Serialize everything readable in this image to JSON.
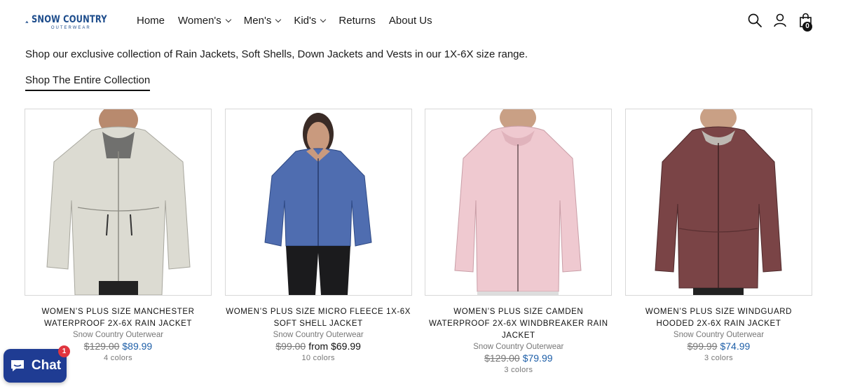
{
  "brand": {
    "name": "SNOW COUNTRY",
    "sub": "OUTERWEAR"
  },
  "nav": [
    {
      "label": "Home",
      "dropdown": false
    },
    {
      "label": "Women's",
      "dropdown": true
    },
    {
      "label": "Men's",
      "dropdown": true
    },
    {
      "label": "Kid's",
      "dropdown": true
    },
    {
      "label": "Returns",
      "dropdown": false
    },
    {
      "label": "About Us",
      "dropdown": false
    }
  ],
  "cart_count": "0",
  "intro": "Shop our exclusive collection of Rain Jackets, Soft Shells, Down Jackets and Vests in our 1X-6X size range.",
  "shop_link": "Shop The Entire Collection",
  "products": [
    {
      "title": "WOMEN’S PLUS SIZE MANCHESTER WATERPROOF 2X-6X RAIN JACKET",
      "vendor": "Snow Country Outerwear",
      "old_price": "$129.00",
      "price": "$89.99",
      "from": "",
      "colors": "4 colors",
      "jacket_color": "#dcdbd2"
    },
    {
      "title": "WOMEN’S PLUS SIZE MICRO FLEECE 1X-6X SOFT SHELL JACKET",
      "vendor": "Snow Country Outerwear",
      "old_price": "$99.00",
      "price": "",
      "from": "from $69.99",
      "colors": "10 colors",
      "jacket_color": "#4f6db0"
    },
    {
      "title": "WOMEN’S PLUS SIZE CAMDEN WATERPROOF 2X-6X WINDBREAKER RAIN JACKET",
      "vendor": "Snow Country Outerwear",
      "old_price": "$129.00",
      "price": "$79.99",
      "from": "",
      "colors": "3 colors",
      "jacket_color": "#efc9d0"
    },
    {
      "title": "WOMEN’S PLUS SIZE WINDGUARD HOODED 2X-6X RAIN JACKET",
      "vendor": "Snow Country Outerwear",
      "old_price": "$99.99",
      "price": "$74.99",
      "from": "",
      "colors": "3 colors",
      "jacket_color": "#7a4446"
    }
  ],
  "chat": {
    "label": "Chat",
    "badge": "1"
  }
}
